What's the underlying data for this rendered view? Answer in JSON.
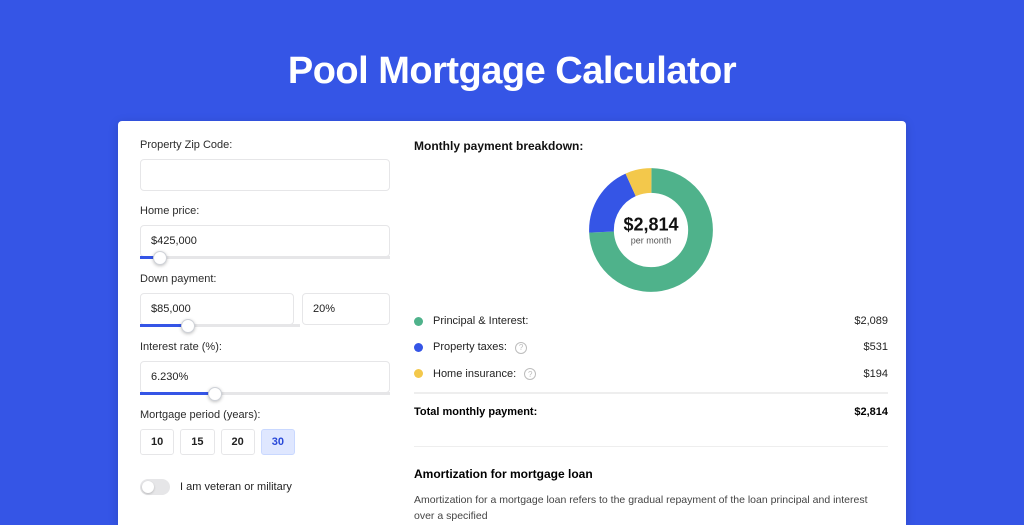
{
  "title": "Pool Mortgage Calculator",
  "form": {
    "zip": {
      "label": "Property Zip Code:",
      "value": ""
    },
    "homePrice": {
      "label": "Home price:",
      "value": "$425,000",
      "sliderPct": 8
    },
    "downPayment": {
      "label": "Down payment:",
      "amount": "$85,000",
      "pct": "20%",
      "sliderPct": 20
    },
    "interest": {
      "label": "Interest rate (%):",
      "value": "6.230%",
      "sliderPct": 30
    },
    "period": {
      "label": "Mortgage period (years):",
      "options": [
        "10",
        "15",
        "20",
        "30"
      ],
      "active": "30"
    },
    "veteran": {
      "label": "I am veteran or military",
      "on": false
    }
  },
  "breakdown": {
    "title": "Monthly payment breakdown:",
    "total": "$2,814",
    "sub": "per month",
    "items": [
      {
        "label": "Principal & Interest:",
        "amount": "$2,089",
        "color": "#4fb28b",
        "info": false
      },
      {
        "label": "Property taxes:",
        "amount": "$531",
        "color": "#3555e6",
        "info": true
      },
      {
        "label": "Home insurance:",
        "amount": "$194",
        "color": "#f3c84b",
        "info": true
      }
    ],
    "totalRow": {
      "label": "Total monthly payment:",
      "amount": "$2,814"
    }
  },
  "chart_data": {
    "type": "pie",
    "title": "Monthly payment breakdown",
    "series": [
      {
        "name": "Principal & Interest",
        "value": 2089,
        "color": "#4fb28b"
      },
      {
        "name": "Property taxes",
        "value": 531,
        "color": "#3555e6"
      },
      {
        "name": "Home insurance",
        "value": 194,
        "color": "#f3c84b"
      }
    ],
    "total": 2814
  },
  "amort": {
    "title": "Amortization for mortgage loan",
    "text": "Amortization for a mortgage loan refers to the gradual repayment of the loan principal and interest over a specified"
  }
}
